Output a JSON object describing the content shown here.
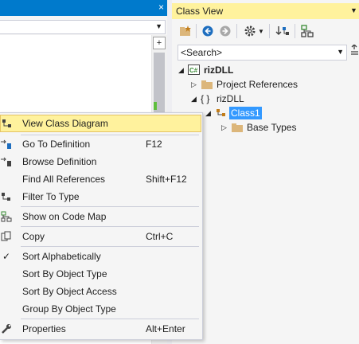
{
  "editor": {
    "close_glyph": "×",
    "split_glyph": "+"
  },
  "class_view": {
    "title": "Class View",
    "search_placeholder": "<Search>",
    "toolbar": [
      "new-folder-icon",
      "back-icon",
      "forward-icon",
      "settings-icon",
      "chevron-down-icon",
      "sync-icon",
      "class-diagram-icon"
    ],
    "tree": [
      {
        "label": "rizDLL",
        "icon": "csharp-project-icon",
        "expanded": true,
        "bold": true
      },
      {
        "label": "Project References",
        "icon": "folder-icon",
        "expanded": false
      },
      {
        "label": "rizDLL",
        "icon": "namespace-icon",
        "expanded": true,
        "prefix": "{ }"
      },
      {
        "label": "Class1",
        "icon": "class-icon",
        "expanded": true,
        "selected": true
      },
      {
        "label": "Base Types",
        "icon": "folder-icon",
        "expanded": false
      }
    ]
  },
  "context_menu": {
    "items": [
      {
        "label": "View Class Diagram",
        "shortcut": "",
        "icon": "class-diagram-icon",
        "highlighted": true
      },
      {
        "label": "Go To Definition",
        "shortcut": "F12",
        "icon": "goto-definition-icon"
      },
      {
        "label": "Browse Definition",
        "shortcut": "",
        "icon": "browse-definition-icon"
      },
      {
        "label": "Find All References",
        "shortcut": "Shift+F12",
        "icon": ""
      },
      {
        "label": "Filter To Type",
        "shortcut": "",
        "icon": "filter-type-icon"
      },
      {
        "label": "Show on Code Map",
        "shortcut": "",
        "icon": "code-map-icon"
      },
      {
        "label": "Copy",
        "shortcut": "Ctrl+C",
        "icon": "copy-icon"
      },
      {
        "label": "Sort Alphabetically",
        "shortcut": "",
        "icon": "check-icon",
        "checked": true
      },
      {
        "label": "Sort By Object Type",
        "shortcut": "",
        "icon": ""
      },
      {
        "label": "Sort By Object Access",
        "shortcut": "",
        "icon": ""
      },
      {
        "label": "Group By Object Type",
        "shortcut": "",
        "icon": ""
      },
      {
        "label": "Properties",
        "shortcut": "Alt+Enter",
        "icon": "wrench-icon"
      }
    ]
  },
  "colors": {
    "accent": "#007acc",
    "title_highlight": "#fff29d",
    "selection": "#3399ff"
  }
}
